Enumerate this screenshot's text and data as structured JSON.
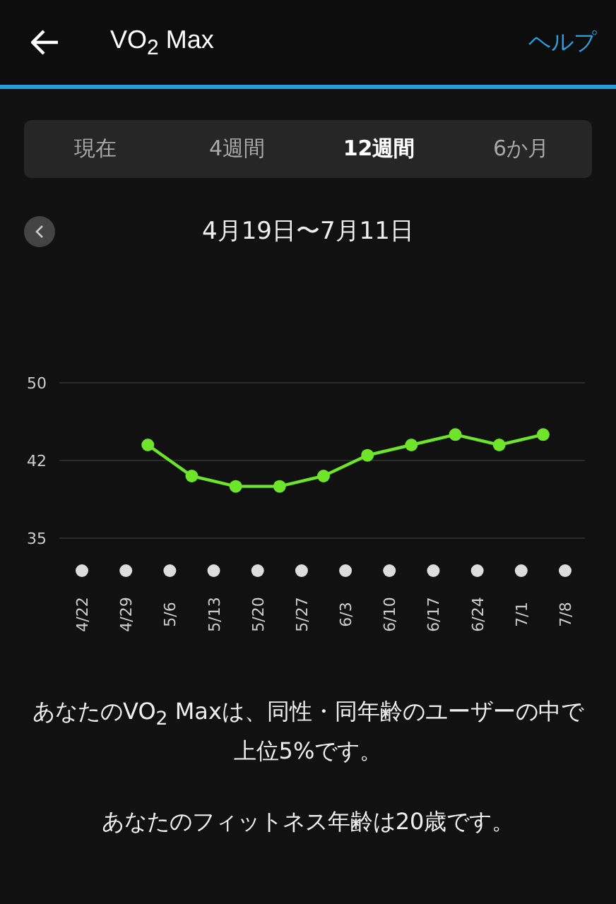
{
  "header": {
    "title": "VO$_{2}$ Max",
    "help": "ヘルプ"
  },
  "tabs": [
    {
      "label": "現在",
      "selected": false
    },
    {
      "label": "4週間",
      "selected": false
    },
    {
      "label": "12週間",
      "selected": true
    },
    {
      "label": "6か月",
      "selected": false
    }
  ],
  "range": {
    "label": "4月19日〜7月11日"
  },
  "chart": {
    "chart_data": {
      "type": "line",
      "categories": [
        "4/22",
        null,
        "4/29",
        null,
        "5/6",
        null,
        "5/13",
        null,
        "5/20",
        null,
        "5/27",
        null,
        "6/3",
        null,
        "6/10",
        null,
        "6/17",
        null,
        "6/24",
        null,
        "7/1",
        null,
        "7/8"
      ],
      "series": [
        {
          "color": "#6ee52a",
          "marker": "circle",
          "values": [
            null,
            null,
            null,
            44,
            null,
            41,
            null,
            40,
            null,
            40,
            null,
            41,
            null,
            43,
            null,
            44,
            null,
            45,
            null,
            44,
            null,
            45,
            null
          ]
        }
      ],
      "ylim": [
        35,
        50
      ],
      "yticks": [
        {
          "value": 35,
          "label": "35"
        },
        {
          "value": 42.5,
          "label": "42"
        },
        {
          "value": 50,
          "label": "50"
        }
      ]
    }
  },
  "summary": [
    "あなたのVO$_{2}$ Maxは、同性・同年齢のユーザーの中で上位5%です。",
    "あなたのフィットネス年齢は20歳です。"
  ]
}
